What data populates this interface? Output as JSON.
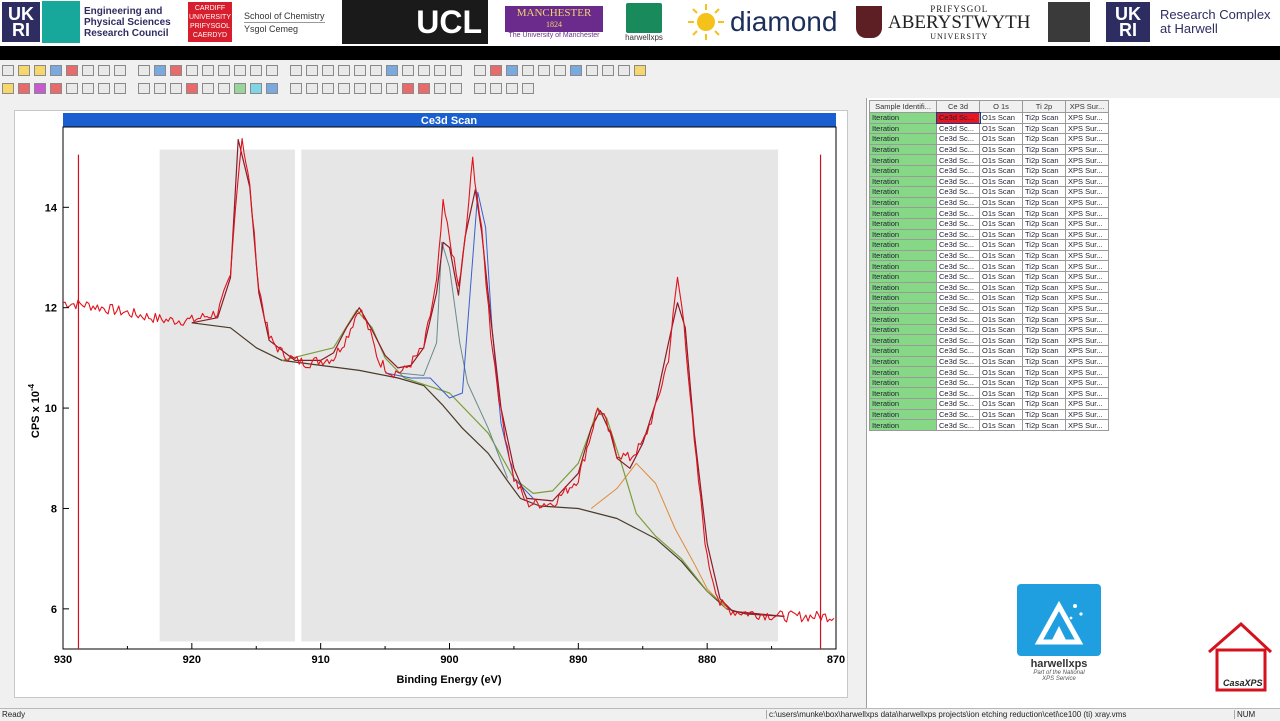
{
  "banner": {
    "ukri_abbrev_1": "UK RI",
    "epsrc_line1": "Engineering and",
    "epsrc_line2": "Physical Sciences",
    "epsrc_line3": "Research Council",
    "cardiff_line1": "CARDIFF",
    "cardiff_line2": "UNIVERSITY",
    "cardiff_line3": "PRIFYSGOL",
    "cardiff_line4": "CAERDYD",
    "chemistry_line1": "School of Chemistry",
    "chemistry_line2": "Ysgol Cemeg",
    "ucl": "UCL",
    "manchester_line1": "MANCHESTER",
    "manchester_line2": "1824",
    "manchester_line3": "The University of Manchester",
    "harwellxps_small": "harwellxps",
    "diamond": "diamond",
    "aber_line1": "PRIFYSGOL",
    "aber_line2": "ABERYSTWYTH",
    "aber_line3": "UNIVERSITY",
    "ukri_abbrev_2": "UK RI",
    "rch_line1": "Research Complex",
    "rch_line2": "at Harwell"
  },
  "chart_data": {
    "type": "line",
    "title": "Ce3d Scan",
    "xlabel": "Binding Energy (eV)",
    "ylabel_main": "CPS x 10",
    "ylabel_exp": "-4",
    "xlim": [
      930,
      870
    ],
    "ylim": [
      5.2,
      15.6
    ],
    "xticks": [
      "930",
      "920",
      "910",
      "900",
      "890",
      "880",
      "870"
    ],
    "yticks": [
      "6",
      "8",
      "10",
      "12",
      "14"
    ],
    "region_1": [
      922.5,
      912
    ],
    "region_2": [
      911.5,
      874.5
    ],
    "markers": [
      928.8,
      871.2
    ],
    "colors": {
      "data": "#e0121b",
      "envelope": "#8b1a2a",
      "background": "#4a3a2a",
      "comp_a": "#7a9e3a",
      "comp_b": "#3a5fcf",
      "comp_c": "#e08a3a",
      "comp_d": "#6a8a8a"
    },
    "series": {
      "data": [
        [
          930,
          12.1
        ],
        [
          928,
          12.05
        ],
        [
          926,
          11.95
        ],
        [
          924,
          11.85
        ],
        [
          922,
          11.75
        ],
        [
          920,
          11.75
        ],
        [
          918,
          11.9
        ],
        [
          917,
          12.6
        ],
        [
          916.5,
          14.4
        ],
        [
          916.1,
          15.4
        ],
        [
          915.5,
          14.4
        ],
        [
          914.8,
          12.4
        ],
        [
          914,
          11.4
        ],
        [
          913,
          11.1
        ],
        [
          912,
          10.95
        ],
        [
          911,
          10.9
        ],
        [
          910,
          10.95
        ],
        [
          909,
          11.0
        ],
        [
          908,
          11.4
        ],
        [
          907,
          12.0
        ],
        [
          906.3,
          11.6
        ],
        [
          905.5,
          10.95
        ],
        [
          904.5,
          10.7
        ],
        [
          903.5,
          10.75
        ],
        [
          902,
          11.2
        ],
        [
          901,
          12.5
        ],
        [
          900.5,
          14.05
        ],
        [
          900,
          13.4
        ],
        [
          899.3,
          12.4
        ],
        [
          898.8,
          13.3
        ],
        [
          898.2,
          14.95
        ],
        [
          897.5,
          13.5
        ],
        [
          896.8,
          11.5
        ],
        [
          896,
          9.9
        ],
        [
          895,
          8.6
        ],
        [
          894,
          8.1
        ],
        [
          892,
          8.1
        ],
        [
          890,
          8.6
        ],
        [
          889,
          9.5
        ],
        [
          888.5,
          10.0
        ],
        [
          888,
          9.8
        ],
        [
          887,
          9.1
        ],
        [
          886,
          9.0
        ],
        [
          885,
          9.3
        ],
        [
          884,
          10.0
        ],
        [
          883,
          11.0
        ],
        [
          882.3,
          12.6
        ],
        [
          881.8,
          11.7
        ],
        [
          881,
          9.3
        ],
        [
          880,
          7.0
        ],
        [
          879,
          6.1
        ],
        [
          878,
          5.95
        ],
        [
          876,
          5.9
        ],
        [
          874,
          5.85
        ],
        [
          872,
          5.85
        ],
        [
          870,
          5.85
        ]
      ],
      "envelope": [
        [
          920,
          11.7
        ],
        [
          918,
          11.8
        ],
        [
          917,
          12.6
        ],
        [
          916.4,
          15.35
        ],
        [
          915.5,
          14.4
        ],
        [
          914.8,
          12.3
        ],
        [
          914,
          11.35
        ],
        [
          912,
          10.95
        ],
        [
          910,
          10.95
        ],
        [
          909,
          11.1
        ],
        [
          908,
          11.6
        ],
        [
          907,
          12.0
        ],
        [
          906,
          11.55
        ],
        [
          905,
          11.05
        ],
        [
          904,
          10.8
        ],
        [
          903,
          10.85
        ],
        [
          902,
          11.2
        ],
        [
          901,
          12.3
        ],
        [
          900.5,
          13.3
        ],
        [
          900,
          13.2
        ],
        [
          899.3,
          12.25
        ],
        [
          898.8,
          13.4
        ],
        [
          898,
          14.35
        ],
        [
          897.5,
          13.5
        ],
        [
          896.8,
          11.8
        ],
        [
          896,
          10.0
        ],
        [
          895,
          8.8
        ],
        [
          894,
          8.2
        ],
        [
          892,
          8.15
        ],
        [
          890,
          8.7
        ],
        [
          889,
          9.6
        ],
        [
          888.3,
          9.95
        ],
        [
          887.5,
          9.5
        ],
        [
          887,
          9.0
        ],
        [
          886,
          8.8
        ],
        [
          885,
          9.3
        ],
        [
          884,
          10.1
        ],
        [
          883,
          11.3
        ],
        [
          882.3,
          12.1
        ],
        [
          881.7,
          11.6
        ],
        [
          881,
          9.5
        ],
        [
          880,
          7.3
        ],
        [
          879,
          6.2
        ],
        [
          878,
          5.95
        ],
        [
          876,
          5.9
        ],
        [
          874,
          5.85
        ]
      ],
      "background": [
        [
          920,
          11.7
        ],
        [
          917,
          11.6
        ],
        [
          915,
          11.2
        ],
        [
          913,
          10.95
        ],
        [
          910,
          10.85
        ],
        [
          907,
          10.75
        ],
        [
          904,
          10.6
        ],
        [
          902,
          10.45
        ],
        [
          900.5,
          10.05
        ],
        [
          899,
          9.6
        ],
        [
          897,
          9.1
        ],
        [
          895.5,
          8.55
        ],
        [
          894.5,
          8.2
        ],
        [
          893,
          8.05
        ],
        [
          890,
          8.0
        ],
        [
          887,
          7.8
        ],
        [
          884,
          7.4
        ],
        [
          882,
          6.95
        ],
        [
          880,
          6.35
        ],
        [
          878.5,
          6.0
        ],
        [
          877,
          5.9
        ],
        [
          874,
          5.85
        ]
      ],
      "comp_a": [
        [
          913,
          10.95
        ],
        [
          909,
          11.2
        ],
        [
          907.2,
          11.95
        ],
        [
          906,
          11.6
        ],
        [
          905,
          11.0
        ],
        [
          903.5,
          10.6
        ],
        [
          900,
          10.3
        ],
        [
          897,
          9.5
        ],
        [
          895,
          8.6
        ],
        [
          893.5,
          8.3
        ],
        [
          892,
          8.35
        ],
        [
          890,
          8.9
        ],
        [
          889,
          9.6
        ],
        [
          888.5,
          10.0
        ],
        [
          887.8,
          9.8
        ],
        [
          886.6,
          8.85
        ],
        [
          885.5,
          7.9
        ],
        [
          884,
          7.45
        ],
        [
          882,
          7.0
        ],
        [
          880,
          6.35
        ],
        [
          878,
          5.95
        ]
      ],
      "comp_b": [
        [
          905,
          10.7
        ],
        [
          903,
          10.6
        ],
        [
          901.5,
          10.6
        ],
        [
          900,
          10.2
        ],
        [
          899,
          10.3
        ],
        [
          898.4,
          12.3
        ],
        [
          897.8,
          14.3
        ],
        [
          897.2,
          13.6
        ],
        [
          896.7,
          11.6
        ],
        [
          896,
          9.7
        ],
        [
          895,
          8.6
        ],
        [
          893.5,
          8.2
        ]
      ],
      "comp_c": [
        [
          889,
          8.0
        ],
        [
          887,
          8.4
        ],
        [
          885.5,
          8.9
        ],
        [
          884,
          8.5
        ],
        [
          882.5,
          7.6
        ],
        [
          881,
          6.9
        ],
        [
          880,
          6.4
        ],
        [
          878.5,
          6.0
        ]
      ],
      "comp_d": [
        [
          904,
          10.7
        ],
        [
          902,
          10.65
        ],
        [
          901,
          11.3
        ],
        [
          900.6,
          13.3
        ],
        [
          900,
          12.8
        ],
        [
          899.2,
          11.3
        ],
        [
          898.6,
          10.5
        ],
        [
          897,
          9.6
        ],
        [
          895.5,
          8.6
        ]
      ]
    }
  },
  "side_panel": {
    "headers": [
      "Sample Identifi...",
      "Ce 3d",
      "O 1s",
      "Ti 2p",
      "XPS Sur..."
    ],
    "row_label": "Iteration",
    "cell_ce3d": "Ce3d Sc...",
    "cell_o1s": "O1s Scan",
    "cell_ti2p": "Ti2p Scan",
    "cell_xps": "XPS Sur...",
    "row_count": 30,
    "harwell_word": "harwellxps",
    "harwell_tag1": "Part of the National",
    "harwell_tag2": "XPS Service",
    "casa_label": "CasaXPS"
  },
  "status": {
    "left": "Ready",
    "path": "c:\\users\\munke\\box\\harwellxps data\\harwellxps projects\\ion etching reduction\\ceti\\ce100 (ti) xray.vms",
    "num": "NUM"
  }
}
